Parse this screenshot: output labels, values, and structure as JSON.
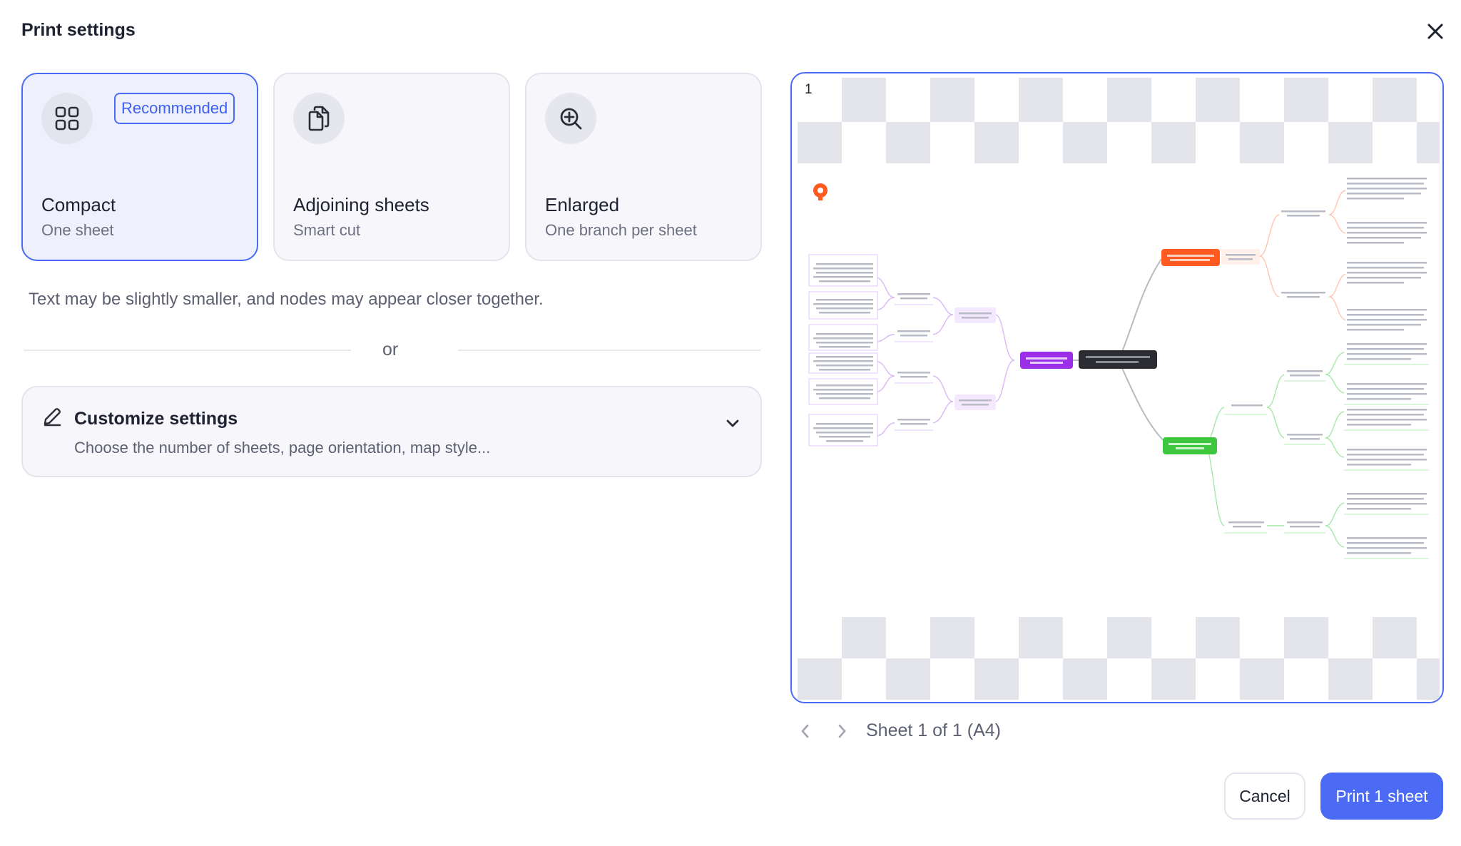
{
  "dialog": {
    "title": "Print settings"
  },
  "options": [
    {
      "title": "Compact",
      "subtitle": "One sheet",
      "badge": "Recommended",
      "icon": "grid-icon",
      "selected": true
    },
    {
      "title": "Adjoining sheets",
      "subtitle": "Smart cut",
      "icon": "copy-pages-icon",
      "selected": false
    },
    {
      "title": "Enlarged",
      "subtitle": "One branch per sheet",
      "icon": "zoom-in-icon",
      "selected": false
    }
  ],
  "hint": "Text may be slightly smaller, and nodes may appear closer together.",
  "separator": "or",
  "customize": {
    "title": "Customize settings",
    "subtitle": "Choose the number of sheets, page orientation, map style..."
  },
  "preview": {
    "page_number": "1",
    "sheet_info": "Sheet 1 of 1 (A4)"
  },
  "footer": {
    "cancel_label": "Cancel",
    "print_label": "Print 1 sheet"
  },
  "colors": {
    "accent": "#4b6bf5",
    "central_node": "#2b2d33",
    "orange_branch": "#ff5a1f",
    "purple_branch": "#9b2fe8",
    "green_branch": "#3ec73e"
  }
}
